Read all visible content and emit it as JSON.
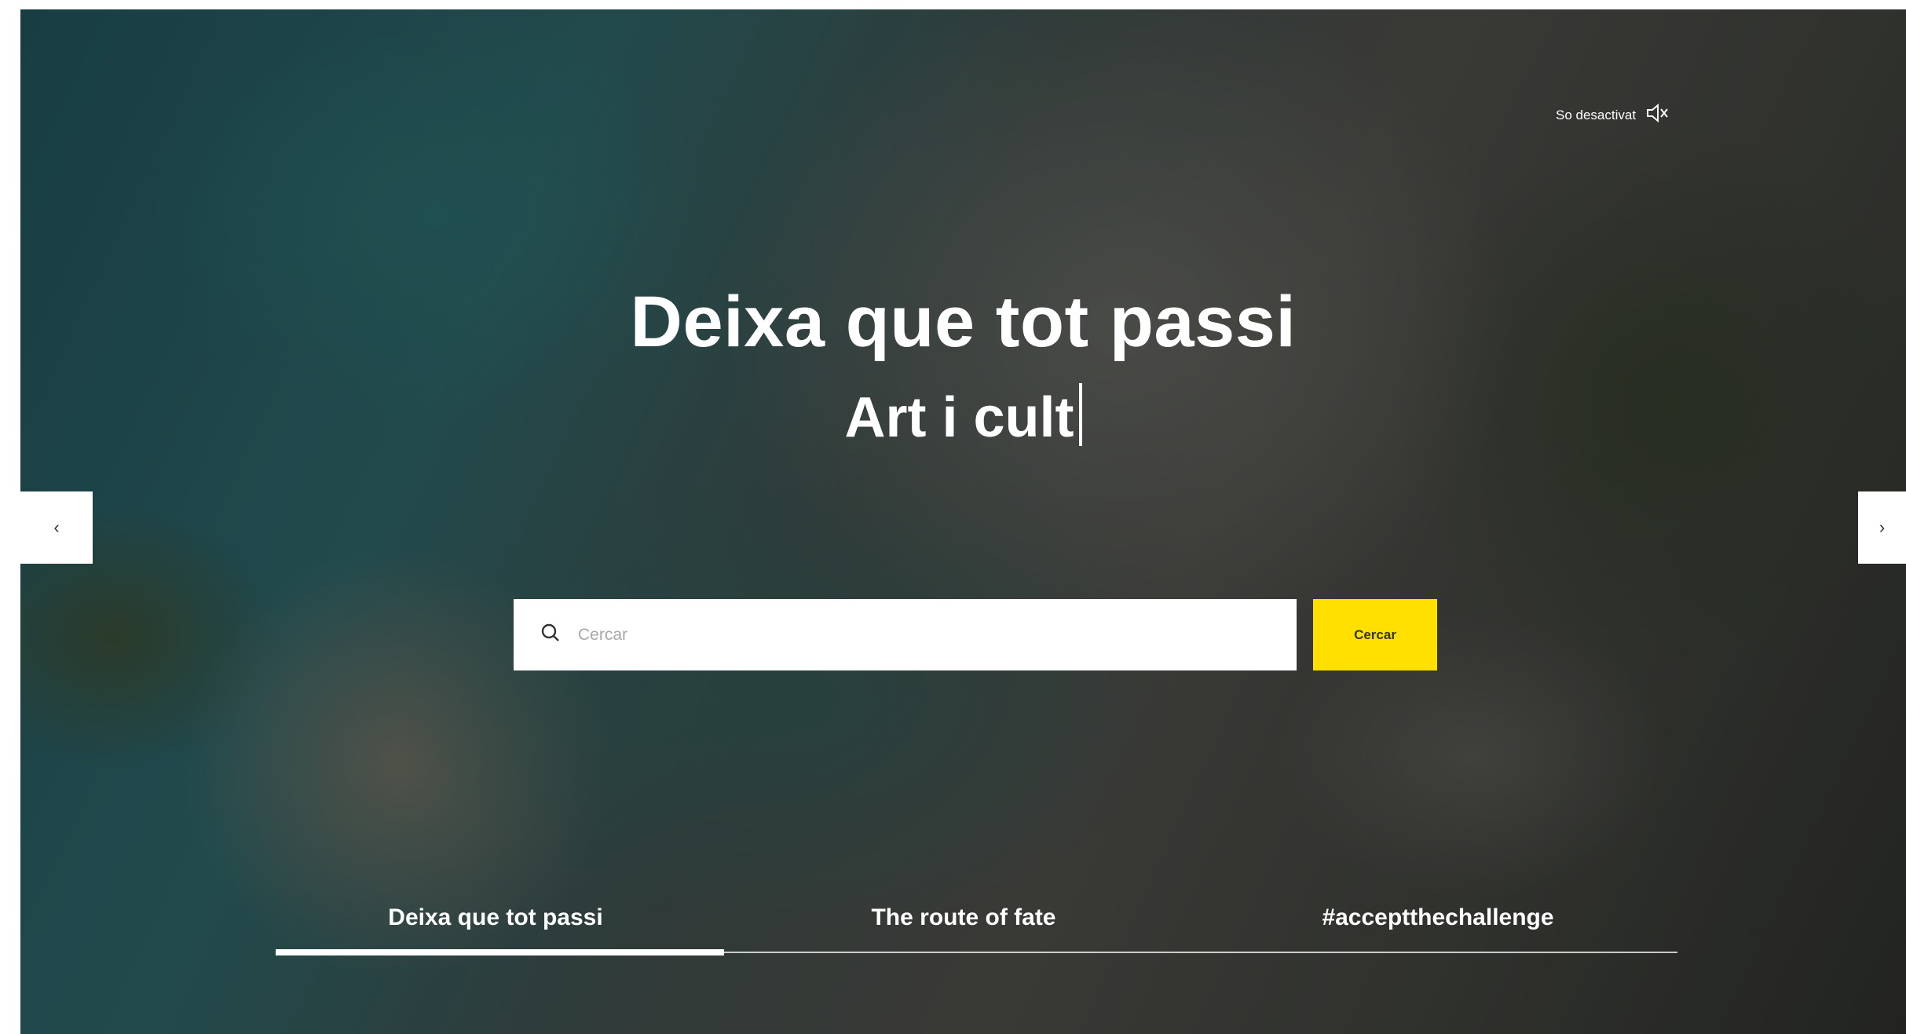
{
  "sound": {
    "label": "So desactivat",
    "icon": "speaker-muted-icon"
  },
  "hero": {
    "title": "Deixa que tot passi",
    "subtitle": "Art i cult"
  },
  "carousel": {
    "prev_label": "‹",
    "next_label": "›"
  },
  "search": {
    "placeholder": "Cercar",
    "value": "",
    "button_label": "Cercar",
    "button_color": "#ffe000"
  },
  "tabs": {
    "items": [
      {
        "label": "Deixa que tot passi",
        "active": true
      },
      {
        "label": "The route of fate",
        "active": false
      },
      {
        "label": "#acceptthechallenge",
        "active": false
      }
    ],
    "progress": 0.32
  }
}
